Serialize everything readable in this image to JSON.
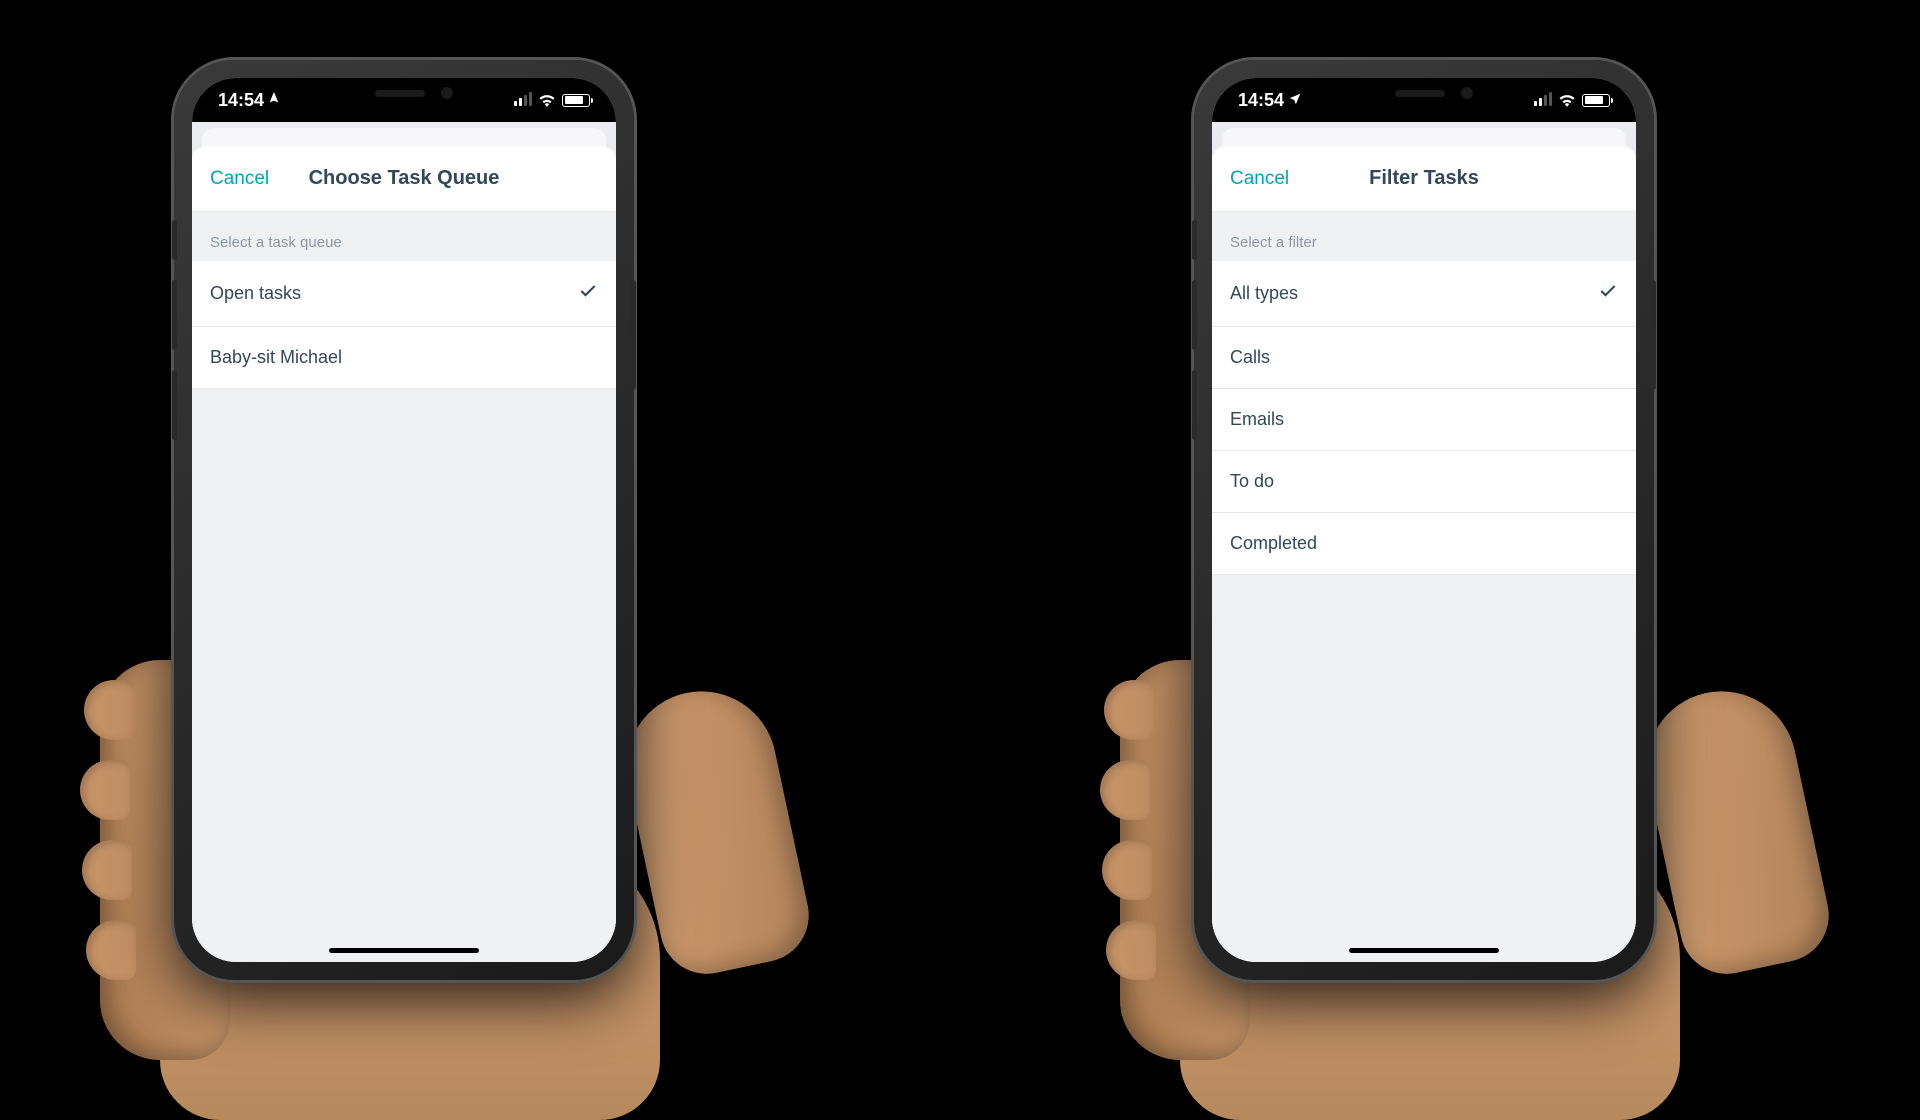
{
  "status": {
    "time": "14:54",
    "locationGlyph": "➤"
  },
  "phones": {
    "left": {
      "cancel": "Cancel",
      "title": "Choose Task Queue",
      "sectionHeader": "Select a task queue",
      "items": [
        {
          "label": "Open tasks",
          "selected": true
        },
        {
          "label": "Baby-sit Michael",
          "selected": false
        }
      ]
    },
    "right": {
      "cancel": "Cancel",
      "title": "Filter Tasks",
      "sectionHeader": "Select a filter",
      "items": [
        {
          "label": "All types",
          "selected": true
        },
        {
          "label": "Calls",
          "selected": false
        },
        {
          "label": "Emails",
          "selected": false
        },
        {
          "label": "To do",
          "selected": false
        },
        {
          "label": "Completed",
          "selected": false
        }
      ]
    }
  }
}
